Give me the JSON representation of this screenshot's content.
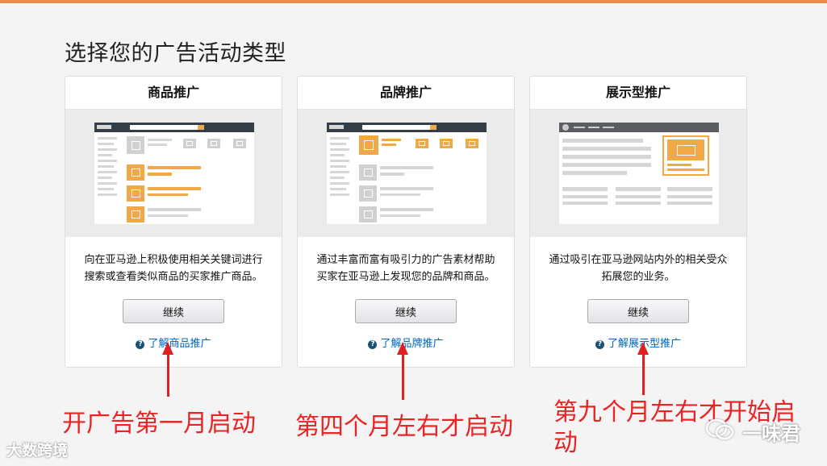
{
  "page": {
    "title": "选择您的广告活动类型"
  },
  "cards": [
    {
      "title": "商品推广",
      "description_line1": "向在亚马逊上积极使用相关关键词进行",
      "description_line2": "搜索或查看类似商品的买家推广商品。",
      "button": "继续",
      "learn_link": "了解商品推广",
      "preview_logo": "amazon"
    },
    {
      "title": "品牌推广",
      "description_line1": "通过丰富而富有吸引力的广告素材帮助",
      "description_line2": "买家在亚马逊上发现您的品牌和商品。",
      "button": "继续",
      "learn_link": "了解品牌推广",
      "preview_logo": "amazon"
    },
    {
      "title": "展示型推广",
      "description_line1": "通过吸引在亚马逊网站内外的相关受众",
      "description_line2": "拓展您的业务。",
      "button": "继续",
      "learn_link": "了解展示型推广"
    }
  ],
  "annotations": [
    {
      "text": "开广告第一月启动"
    },
    {
      "text": "第四个月左右才启动"
    },
    {
      "text_line1": "第九个月左右才开始启",
      "text_line2": "动"
    }
  ],
  "watermarks": {
    "left": "大数跨境",
    "right": "一味君"
  },
  "colors": {
    "accent": "#f3a847",
    "link": "#0066c0",
    "annotation": "#e82424",
    "topbar": "#f08a4b"
  }
}
